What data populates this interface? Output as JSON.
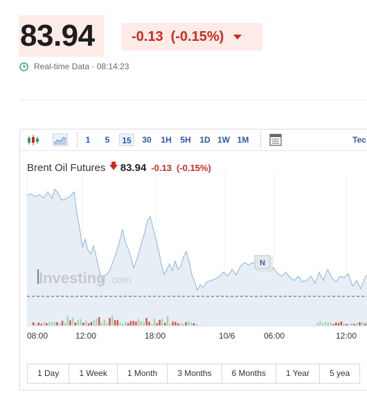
{
  "quote": {
    "last": "83.94",
    "change": "-0.13",
    "change_pct": "(-0.15%)",
    "realtime_label": "Real-time Data · 08:14:23"
  },
  "toolbar": {
    "intervals": [
      "1",
      "5",
      "15",
      "30",
      "1H",
      "5H",
      "1D",
      "1W",
      "1M"
    ],
    "active_interval": "15",
    "tech_label": "Tec"
  },
  "chart": {
    "instrument": "Brent Oil Futures",
    "last": "83.94",
    "change": "-0.13",
    "change_pct": "(-0.15%)",
    "watermark": "Investing",
    "watermark_suffix": ".com",
    "event_marker": "N",
    "x_labels": [
      "08:00",
      "12:00",
      "18:00",
      "10/6",
      "06:00",
      "12:00"
    ]
  },
  "ranges": [
    "1 Day",
    "1 Week",
    "1 Month",
    "3 Months",
    "6 Months",
    "1 Year",
    "5 yea"
  ],
  "colors": {
    "down": "#d0291f",
    "up": "#8fd0a8",
    "line": "#8cb2d8",
    "area": "#e7eef6",
    "link": "#2a5aa8"
  }
}
